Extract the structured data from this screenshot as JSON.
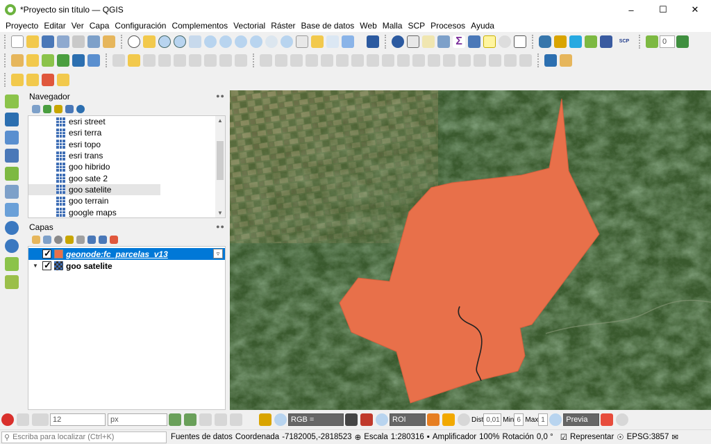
{
  "window": {
    "title": "*Proyecto sin título — QGIS"
  },
  "menu": [
    "Proyecto",
    "Editar",
    "Ver",
    "Capa",
    "Configuración",
    "Complementos",
    "Vectorial",
    "Ráster",
    "Base de datos",
    "Web",
    "Malla",
    "SCP",
    "Procesos",
    "Ayuda"
  ],
  "navigator": {
    "title": "Navegador",
    "items": [
      "esri street",
      "esri terra",
      "esri topo",
      "esri trans",
      "goo hibrido",
      "goo sate 2",
      "goo satelite",
      "goo terrain",
      "google maps"
    ],
    "selected_index": 6
  },
  "layers": {
    "title": "Capas",
    "items": [
      {
        "name": "geonode:fc_parcelas_v13",
        "checked": true,
        "selected": true
      },
      {
        "name": "goo satelite",
        "checked": true,
        "selected": false
      }
    ]
  },
  "toolbar": {
    "spin_value": "0",
    "snap_tolerance": "12",
    "snap_units": "px",
    "scp_label": "SCP",
    "rgb_label": "RGB =",
    "roi_label": "ROI",
    "dist_label": "Dist",
    "dist_value": "0,01",
    "min_label": "Min",
    "min_value": "6",
    "max_label": "Max",
    "max_value": "1",
    "preview_label": "Previa"
  },
  "status": {
    "search_placeholder": "Escriba para localizar (Ctrl+K)",
    "data_sources": "Fuentes de datos",
    "coord_label": "Coordenada",
    "coord_value": "-7182005,-2818523",
    "scale_label": "Escala",
    "scale_value": "1:280316",
    "magnifier_label": "Amplificador",
    "magnifier_value": "100%",
    "rotation_label": "Rotación",
    "rotation_value": "0,0 °",
    "render_label": "Representar",
    "crs": "EPSG:3857"
  },
  "colors": {
    "polygon": "#e8704a",
    "selection": "#0078d7"
  }
}
